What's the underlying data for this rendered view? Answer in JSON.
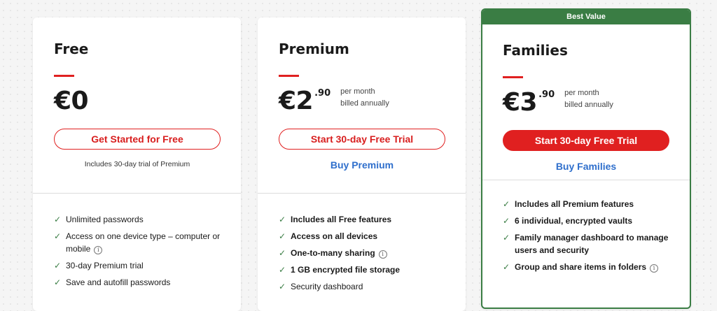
{
  "plans": {
    "free": {
      "name": "Free",
      "price_main": "€0",
      "cta": "Get Started for Free",
      "note": "Includes 30-day trial of Premium",
      "features": [
        {
          "text": "Unlimited passwords",
          "info": false
        },
        {
          "text": "Access on one device type – computer or mobile",
          "info": true
        },
        {
          "text": "30-day Premium trial",
          "info": false
        },
        {
          "text": "Save and autofill passwords",
          "info": false
        }
      ]
    },
    "premium": {
      "name": "Premium",
      "price_main": "€2",
      "price_cents": ".90",
      "price_note_1": "per month",
      "price_note_2": "billed annually",
      "cta": "Start 30-day Free Trial",
      "buy_link": "Buy Premium",
      "features": [
        {
          "text": "Includes all Free features",
          "info": false
        },
        {
          "text": "Access on all devices",
          "info": false
        },
        {
          "text": "One-to-many sharing",
          "info": true
        },
        {
          "text": "1 GB encrypted file storage",
          "info": false
        },
        {
          "text": "Security dashboard",
          "info": false
        }
      ]
    },
    "families": {
      "banner": "Best Value",
      "name": "Families",
      "price_main": "€3",
      "price_cents": ".90",
      "price_note_1": "per month",
      "price_note_2": "billed annually",
      "cta": "Start 30-day Free Trial",
      "buy_link": "Buy Families",
      "features": [
        {
          "text": "Includes all Premium features",
          "info": false
        },
        {
          "text": "6 individual, encrypted vaults",
          "info": false
        },
        {
          "text": "Family manager dashboard to manage users and security",
          "info": false
        },
        {
          "text": "Group and share items in folders",
          "info": true
        }
      ]
    }
  },
  "icons": {
    "check": "checkmark-icon",
    "info": "info-icon"
  },
  "colors": {
    "accent_red": "#e02020",
    "green": "#3a7d44",
    "link_blue": "#2f6fcc"
  }
}
